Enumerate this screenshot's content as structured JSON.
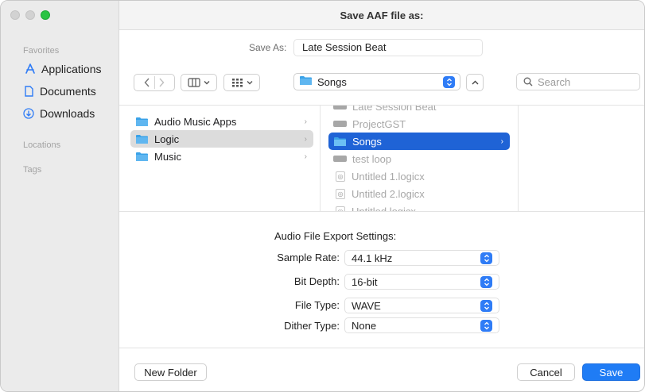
{
  "window": {
    "title": "Save AAF file as:"
  },
  "sidebar": {
    "favorites_heading": "Favorites",
    "items": [
      {
        "label": "Applications",
        "icon": "applications-icon"
      },
      {
        "label": "Documents",
        "icon": "document-icon"
      },
      {
        "label": "Downloads",
        "icon": "download-icon"
      }
    ],
    "locations_heading": "Locations",
    "tags_heading": "Tags"
  },
  "save_as": {
    "label": "Save As:",
    "value": "Late Session Beat"
  },
  "toolbar": {
    "location": "Songs",
    "search_placeholder": "Search"
  },
  "browser": {
    "column1": [
      {
        "label": "Audio Music Apps",
        "selected": false
      },
      {
        "label": "Logic",
        "selected": true
      },
      {
        "label": "Music",
        "selected": false
      }
    ],
    "column2": [
      {
        "label": "Late Session Beat",
        "kind": "drive"
      },
      {
        "label": "ProjectGST",
        "kind": "drive"
      },
      {
        "label": "Songs",
        "kind": "folder",
        "selected": true
      },
      {
        "label": "test loop",
        "kind": "drive"
      },
      {
        "label": "Untitled 1.logicx",
        "kind": "doc"
      },
      {
        "label": "Untitled 2.logicx",
        "kind": "doc"
      },
      {
        "label": "Untitled.logicx",
        "kind": "doc"
      }
    ]
  },
  "settings": {
    "title": "Audio File Export Settings:",
    "sample_rate": {
      "label": "Sample Rate:",
      "value": "44.1 kHz"
    },
    "bit_depth": {
      "label": "Bit Depth:",
      "value": "16-bit"
    },
    "file_type": {
      "label": "File Type:",
      "value": "WAVE"
    },
    "dither_type": {
      "label": "Dither Type:",
      "value": "None"
    }
  },
  "buttons": {
    "new_folder": "New Folder",
    "cancel": "Cancel",
    "save": "Save"
  },
  "colors": {
    "accent": "#1f7cf5",
    "selection": "#1f63d6",
    "folder": "#3aa2e8"
  }
}
